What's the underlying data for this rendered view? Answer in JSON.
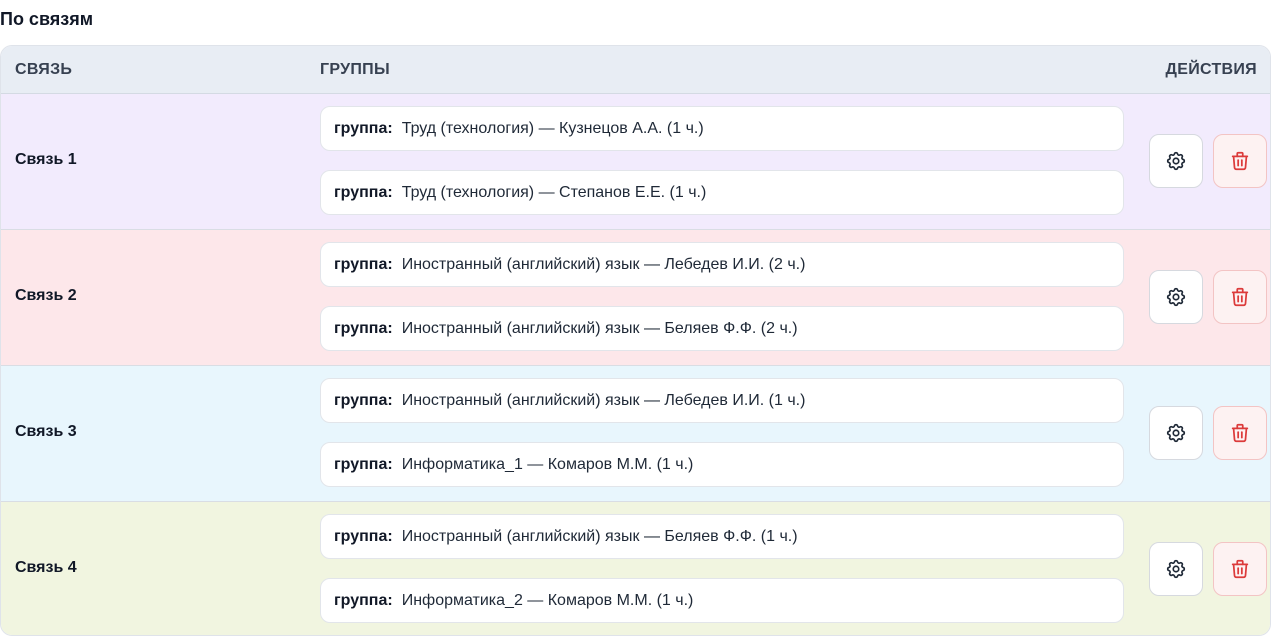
{
  "section_title": "По связям",
  "table": {
    "headers": {
      "link": "СВЯЗЬ",
      "groups": "ГРУППЫ",
      "actions": "ДЕЙСТВИЯ"
    },
    "group_label": "группа:",
    "rows": [
      {
        "name": "Связь 1",
        "color": "#f2ebfd",
        "groups": [
          "Труд (технология) — Кузнецов А.А. (1 ч.)",
          "Труд (технология) — Степанов Е.Е. (1 ч.)"
        ]
      },
      {
        "name": "Связь 2",
        "color": "#fde7ea",
        "groups": [
          "Иностранный (английский) язык — Лебедев И.И. (2 ч.)",
          "Иностранный (английский) язык — Беляев Ф.Ф. (2 ч.)"
        ]
      },
      {
        "name": "Связь 3",
        "color": "#e8f6fd",
        "groups": [
          "Иностранный (английский) язык — Лебедев И.И. (1 ч.)",
          "Информатика_1 — Комаров М.М. (1 ч.)"
        ]
      },
      {
        "name": "Связь 4",
        "color": "#f1f5e0",
        "groups": [
          "Иностранный (английский) язык — Беляев Ф.Ф. (1 ч.)",
          "Информатика_2 — Комаров М.М. (1 ч.)"
        ]
      }
    ],
    "actions": {
      "settings_icon": "gear-icon",
      "delete_icon": "trash-icon",
      "delete_color": "#dc3b3b"
    }
  }
}
